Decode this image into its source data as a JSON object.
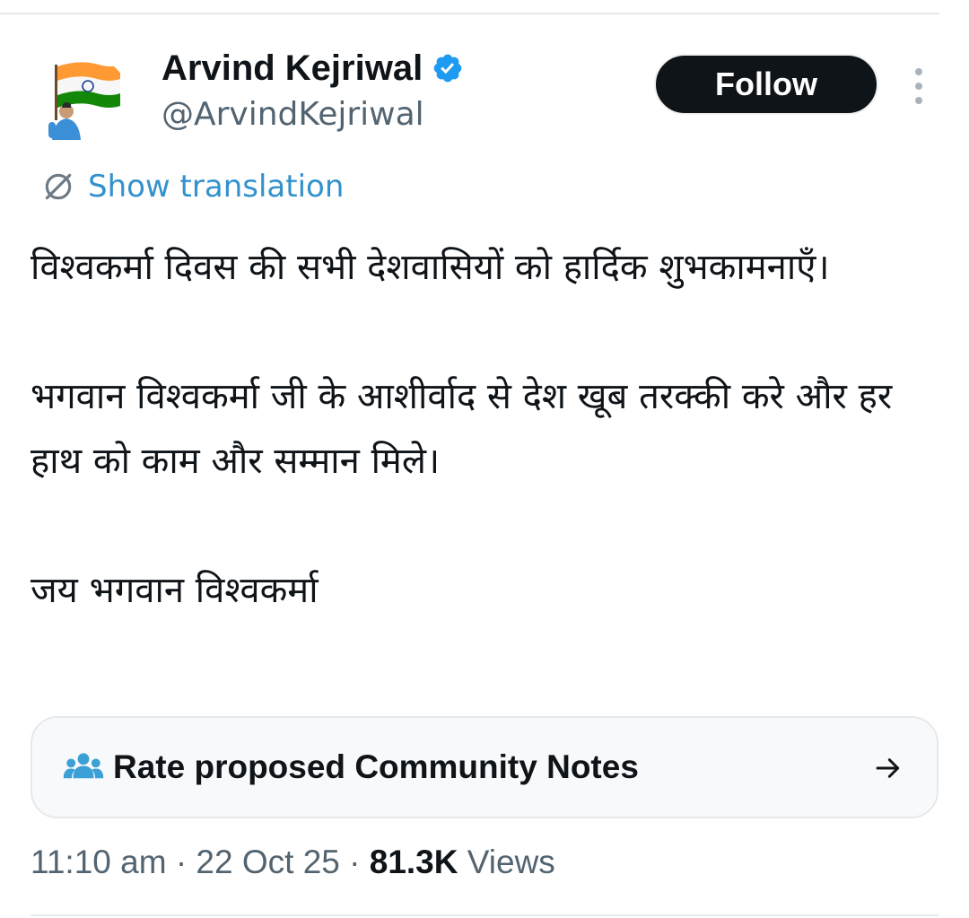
{
  "author": {
    "display_name": "Arvind Kejriwal",
    "handle": "@ArvindKejriwal"
  },
  "follow_label": "Follow",
  "translation_label": "Show translation",
  "tweet_text": [
    "विश्वकर्मा दिवस की सभी देशवासियों को हार्दिक शुभकामनाएँ।",
    "भगवान विश्वकर्मा जी के आशीर्वाद से देश खूब तरक्की करे और हर हाथ को काम और सम्मान मिले।",
    "जय भगवान विश्वकर्मा"
  ],
  "community_notes_label": "Rate proposed Community Notes",
  "meta": {
    "time": "11:10 am",
    "separator": "·",
    "date": "22 Oct 25",
    "views_count": "81.3K",
    "views_label": "Views"
  },
  "icons": {
    "verified": "verified-badge-icon",
    "more": "more-vertical-icon",
    "translate": "globe-slash-icon",
    "community": "people-icon",
    "arrow": "arrow-right-icon"
  },
  "colors": {
    "verified_blue": "#1d9bf0",
    "link_blue": "#3391cc",
    "text_primary": "#0f1419",
    "text_secondary": "#536471",
    "community_icon": "#3ba0d6"
  }
}
